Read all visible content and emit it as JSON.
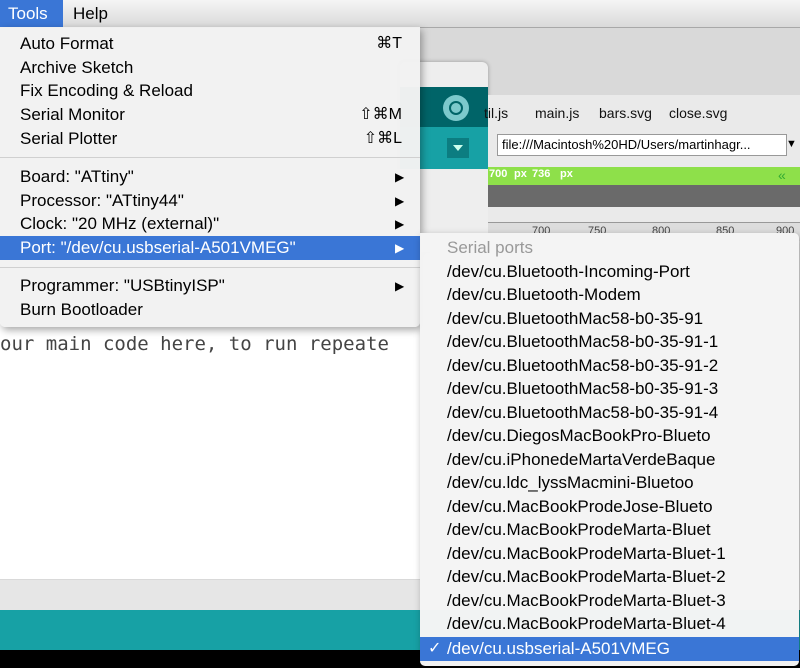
{
  "menubar": {
    "tools": "Tools",
    "help": "Help"
  },
  "ide": {
    "code_line": "our main code here, to run repeate"
  },
  "browser": {
    "tabs": [
      "til.js",
      "main.js",
      "bars.svg",
      "close.svg"
    ],
    "url": "file:///Macintosh%20HD/Users/martinhagr...",
    "ruler_px_a": "px",
    "ruler_value": "736",
    "ruler_px_b": "px",
    "ruler_chevron": "«",
    "ruler_prefix": "700",
    "scale": [
      "700",
      "750",
      "800",
      "850",
      "900"
    ]
  },
  "tools_menu": {
    "items": [
      {
        "label": "Auto Format",
        "shortcut": "⌘T"
      },
      {
        "label": "Archive Sketch",
        "shortcut": ""
      },
      {
        "label": "Fix Encoding & Reload",
        "shortcut": ""
      },
      {
        "label": "Serial Monitor",
        "shortcut": "⇧⌘M"
      },
      {
        "label": "Serial Plotter",
        "shortcut": "⇧⌘L"
      },
      {
        "label": "Board: \"ATtiny\"",
        "shortcut": ""
      },
      {
        "label": "Processor: \"ATtiny44\"",
        "shortcut": ""
      },
      {
        "label": "Clock: \"20 MHz (external)\"",
        "shortcut": ""
      },
      {
        "label": "Port: \"/dev/cu.usbserial-A501VMEG\"",
        "shortcut": ""
      },
      {
        "label": "Programmer: \"USBtinyISP\"",
        "shortcut": ""
      },
      {
        "label": "Burn Bootloader",
        "shortcut": ""
      }
    ]
  },
  "port_menu": {
    "header": "Serial ports",
    "ports": [
      "/dev/cu.Bluetooth-Incoming-Port",
      "/dev/cu.Bluetooth-Modem",
      "/dev/cu.BluetoothMac58-b0-35-91",
      "/dev/cu.BluetoothMac58-b0-35-91-1",
      "/dev/cu.BluetoothMac58-b0-35-91-2",
      "/dev/cu.BluetoothMac58-b0-35-91-3",
      "/dev/cu.BluetoothMac58-b0-35-91-4",
      "/dev/cu.DiegosMacBookPro-Blueto",
      "/dev/cu.iPhonedeMartaVerdeBaque",
      "/dev/cu.ldc_lyssMacmini-Bluetoo",
      "/dev/cu.MacBookProdeJose-Blueto",
      "/dev/cu.MacBookProdeMarta-Bluet",
      "/dev/cu.MacBookProdeMarta-Bluet-1",
      "/dev/cu.MacBookProdeMarta-Bluet-2",
      "/dev/cu.MacBookProdeMarta-Bluet-3",
      "/dev/cu.MacBookProdeMarta-Bluet-4",
      "/dev/cu.usbserial-A501VMEG"
    ],
    "selected_check": "✓"
  },
  "colors": {
    "highlight": "#3a76d6",
    "teal": "#17a1a5",
    "teal_dark": "#006468",
    "ruler_green": "#8ee04a"
  }
}
